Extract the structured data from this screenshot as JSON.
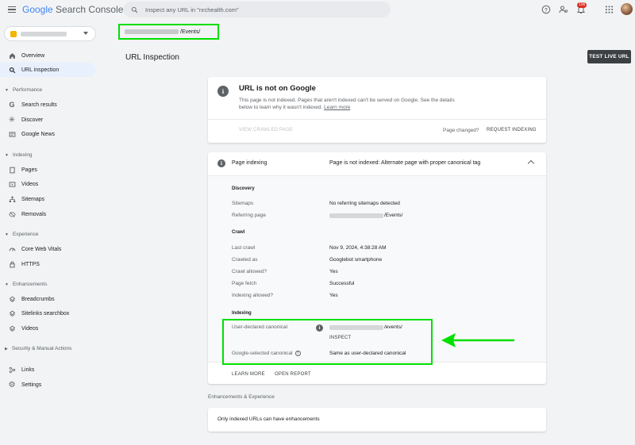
{
  "app": {
    "logo_google": "Google",
    "logo_product": "Search Console"
  },
  "search": {
    "placeholder": "Inspect any URL in \"nrchealth.com\""
  },
  "header": {
    "notification_count": "106"
  },
  "url_bar": {
    "path": "/Events/"
  },
  "page": {
    "title": "URL Inspection",
    "test_live_url": "TEST LIVE URL"
  },
  "sidebar": {
    "overview": "Overview",
    "url_inspection": "URL inspection",
    "performance_section": "Performance",
    "search_results": "Search results",
    "discover": "Discover",
    "google_news": "Google News",
    "indexing_section": "Indexing",
    "pages": "Pages",
    "videos": "Videos",
    "sitemaps": "Sitemaps",
    "removals": "Removals",
    "experience_section": "Experience",
    "core_web_vitals": "Core Web Vitals",
    "https": "HTTPS",
    "enhancements_section": "Enhancements",
    "breadcrumbs": "Breadcrumbs",
    "sitelinks_searchbox": "Sitelinks searchbox",
    "enh_videos": "Videos",
    "security_section": "Security & Manual Actions",
    "links": "Links",
    "settings": "Settings"
  },
  "status_card": {
    "title": "URL is not on Google",
    "description": "This page is not indexed. Pages that aren't indexed can't be served on Google. See the details below to learn why it wasn't indexed.",
    "learn_more": "Learn more",
    "view_crawled": "VIEW CRAWLED PAGE",
    "page_changed": "Page changed?",
    "request_indexing": "REQUEST INDEXING"
  },
  "indexing_card": {
    "label": "Page indexing",
    "status": "Page is not indexed: Alternate page with proper canonical tag",
    "discovery_heading": "Discovery",
    "sitemaps_label": "Sitemaps",
    "sitemaps_value": "No referring sitemaps detected",
    "referring_label": "Referring page",
    "referring_value": "/Events/",
    "crawl_heading": "Crawl",
    "last_crawl_label": "Last crawl",
    "last_crawl_value": "Nov 9, 2024, 4:38:28 AM",
    "crawled_as_label": "Crawled as",
    "crawled_as_value": "Googlebot smartphone",
    "crawl_allowed_label": "Crawl allowed?",
    "crawl_allowed_value": "Yes",
    "page_fetch_label": "Page fetch",
    "page_fetch_value": "Successful",
    "indexing_allowed_label": "Indexing allowed?",
    "indexing_allowed_value": "Yes",
    "indexing_heading": "Indexing",
    "user_canonical_label": "User-declared canonical",
    "user_canonical_value": "/events/",
    "inspect": "INSPECT",
    "google_canonical_label": "Google-selected canonical",
    "google_canonical_value": "Same as user-declared canonical",
    "learn_more": "LEARN MORE",
    "open_report": "OPEN REPORT"
  },
  "enhancements": {
    "title": "Enhancements & Experience",
    "message": "Only indexed URLs can have enhancements"
  },
  "colors": {
    "highlight": "#00e000",
    "accent": "#1a73e8"
  }
}
